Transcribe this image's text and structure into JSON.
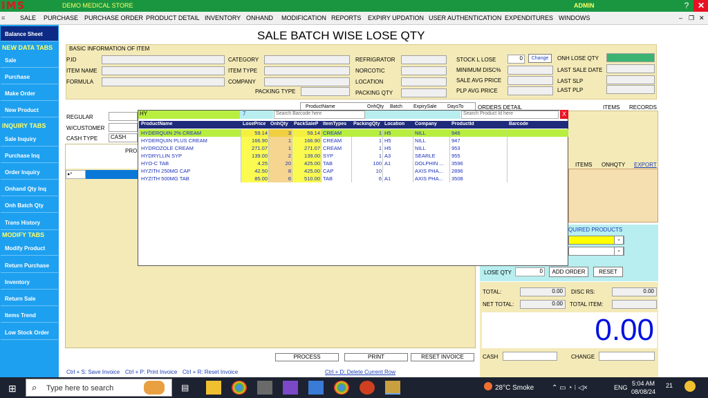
{
  "titlebar": {
    "logo": "IMS",
    "store": "DEMO MEDICAL STORE",
    "user": "ADMIN"
  },
  "menu": [
    "SALE",
    "PURCHASE",
    "PURCHASE ORDER",
    "PRODUCT DETAIL",
    "INVENTORY",
    "ONHAND",
    "MODIFICATION",
    "REPORTS",
    "EXPIRY UPDATION",
    "USER AUTHENTICATION",
    "EXPENDITURES",
    "WINDOWS"
  ],
  "sidebar": {
    "top": "Balance Sheet",
    "h_new": "NEW DATA TABS",
    "new": [
      "Sale",
      "Purchase",
      "Make Order",
      "New Product"
    ],
    "h_inquiry": "INQUIRY TABS",
    "inquiry": [
      "Sale Inquiry",
      "Purchase Inq",
      "Order Inquiry",
      "Onhand Qty Inq",
      "Onh Batch Qty",
      "Trans History"
    ],
    "h_modify": "MODIFY TABS",
    "modify": [
      "Modify Product",
      "Return Purchase",
      "Inventory",
      "Return Sale",
      "Items Trend",
      "Low Stock Order"
    ]
  },
  "page_title": "SALE BATCH WISE LOSE QTY",
  "info": {
    "header": "BASIC INFORMATION OF ITEM",
    "pid": "P.ID",
    "item_name": "ITEM NAME",
    "formula": "FORMULA",
    "category": "CATEGORY",
    "item_type": "ITEM TYPE",
    "company": "COMPANY",
    "packing_type": "PACKING TYPE",
    "refrigrator": "REFRIGRATOR",
    "norcotic": "NORCOTIC",
    "location": "LOCATION",
    "packing_qty": "PACKING QTY",
    "stock_l_lose": "STOCK L LOSE",
    "stock_l_lose_val": "0",
    "change_btn": "Change",
    "min_disc": "MINIMUM DISC%",
    "sale_avg": "SALE AVG PRICE",
    "plp_avg": "PLP AVG PRICE",
    "onh_lose_qty": "ONH LOSE QTY",
    "last_sale_date": "LAST SALE DATE",
    "last_slp": "LAST SLP",
    "last_plp": "LAST PLP"
  },
  "sale": {
    "regular": "REGULAR",
    "wcustomer": "W/CUSTOMER",
    "cash_type": "CASH TYPE",
    "cash_type_val": "CASH",
    "grid_col": "PRO"
  },
  "orders": {
    "col1": "ProductName",
    "col2": "OnhQty",
    "col3": "Batch",
    "col4": "ExpirySale",
    "col5": "DaysTo",
    "orders_detail": "ORDERS  DETAIL",
    "items": "ITEMS",
    "records": "RECORDS"
  },
  "right": {
    "items": "ITEMS",
    "onhqty": "ONHQTY",
    "export": "EXPORT",
    "required": "QUIRED PRODUCTS"
  },
  "popup": {
    "search_value": "HY",
    "count": "7",
    "barcode_ph": "Search Barcode here",
    "pid_ph": "Search Product Id here",
    "close": "X",
    "columns": [
      "ProductName",
      "LosePrice",
      "OnhQty",
      "PackSaleP",
      "ItemTypes",
      "PackingQty",
      "Location",
      "Company",
      "ProductId",
      "Barcode"
    ],
    "rows": [
      [
        "HYDERQUIN 2% CREAM",
        "59.14",
        "3",
        "59.14",
        "CREAM",
        "1",
        "H5",
        "NILL",
        "946",
        ""
      ],
      [
        "HYDERQUIN PLUS CREAM",
        "166.90",
        "1",
        "166.90",
        "CREAM",
        "1",
        "H5",
        "NILL",
        "947",
        ""
      ],
      [
        "HYDROZOLE CREAM",
        "271.07",
        "1",
        "271.07",
        "CREAM",
        "1",
        "H5",
        "NILL",
        "953",
        ""
      ],
      [
        "HYDRYLLIN SYP",
        "139.00",
        "2",
        "139.00",
        "SYP",
        "1",
        "A3",
        "SEARLE",
        "955",
        ""
      ],
      [
        "HYO-C TAB",
        "4.25",
        "20",
        "425.00",
        "TAB",
        "100",
        "A1",
        "DOLPHIN ...",
        "3596",
        ""
      ],
      [
        "HYZITH 250MG CAP",
        "42.50",
        "8",
        "425.00",
        "CAP",
        "10",
        "",
        "AXIS PHA...",
        "2896",
        ""
      ],
      [
        "HYZITH 500MG TAB",
        "85.00",
        "6",
        "510.00",
        "TAB",
        "6",
        "A1",
        "AXIS PHA...",
        "3508",
        ""
      ]
    ]
  },
  "lose": {
    "lose_qty": "LOSE QTY",
    "lose_val": "0",
    "add_order": "ADD ORDER",
    "reset": "RESET"
  },
  "totals": {
    "total": "TOTAL:",
    "total_val": "0.00",
    "disc": "DISC RS:",
    "disc_val": "0.00",
    "net_total": "NET TOTAL:",
    "net_val": "0.00",
    "total_item": "TOTAL ITEM:",
    "big": "0.00",
    "cash": "CASH",
    "change": "CHANGE"
  },
  "actions": {
    "process": "PROCESS",
    "print": "PRINT",
    "reset_invoice": "RESET INVOICE"
  },
  "shortcuts": {
    "save": "Ctrl + S: Save Invoice",
    "print": "Ctrl + P: Print Invoice",
    "reset": "Ctrl + R: Reset Invoice",
    "delete": "Ctrl + D: Delete Current Row"
  },
  "taskbar": {
    "search": "Type here to search",
    "weather": "28°C  Smoke",
    "lang": "ENG",
    "time": "5:04 AM",
    "date": "08/08/24",
    "notif": "21"
  },
  "colors": {
    "green": "#1a9641",
    "sidebar": "#1ea0f0",
    "panel": "#f4eab8",
    "gridhead": "#1e2a7a",
    "highlight": "#b8ee40",
    "bignum": "#0010e0"
  }
}
